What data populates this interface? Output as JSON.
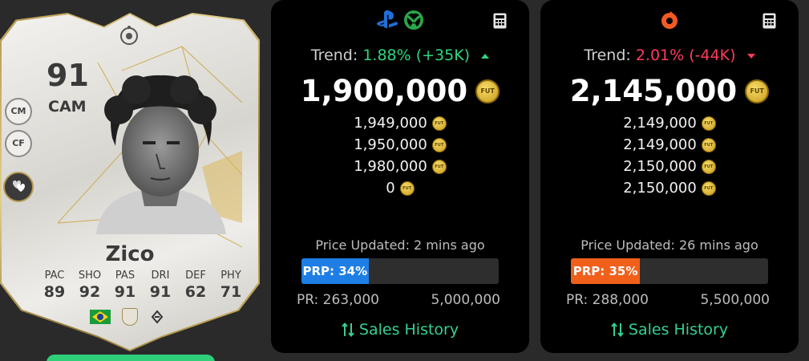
{
  "card": {
    "rating": "91",
    "position": "CAM",
    "alt_positions": [
      "CM",
      "CF"
    ],
    "name": "Zico",
    "stats": [
      {
        "label": "PAC",
        "value": "89"
      },
      {
        "label": "SHO",
        "value": "92"
      },
      {
        "label": "PAS",
        "value": "91"
      },
      {
        "label": "DRI",
        "value": "91"
      },
      {
        "label": "DEF",
        "value": "62"
      },
      {
        "label": "PHY",
        "value": "71"
      }
    ],
    "nation_icon": "brazil-flag",
    "club_icon": "icons-club-badge",
    "league_icon": "icons-league-badge"
  },
  "panels": {
    "console": {
      "platform_icons": [
        "playstation-icon",
        "xbox-icon"
      ],
      "trend_label": "Trend:",
      "trend_value": "1.88% (+35K)",
      "trend_direction": "up",
      "price": "1,900,000",
      "coin_label": "FUT",
      "bins": [
        "1,949,000",
        "1,950,000",
        "1,980,000",
        "0"
      ],
      "updated": "Price Updated: 2 mins ago",
      "prp_label": "PRP: 34%",
      "prp_percent": 34,
      "pr_min": "PR: 263,000",
      "pr_max": "5,000,000",
      "sales_label": "Sales History"
    },
    "pc": {
      "platform_icons": [
        "origin-icon"
      ],
      "trend_label": "Trend:",
      "trend_value": "2.01% (-44K)",
      "trend_direction": "down",
      "price": "2,145,000",
      "coin_label": "FUT",
      "bins": [
        "2,149,000",
        "2,149,000",
        "2,150,000",
        "2,150,000"
      ],
      "updated": "Price Updated: 26 mins ago",
      "prp_label": "PRP: 35%",
      "prp_percent": 35,
      "pr_min": "PR: 288,000",
      "pr_max": "5,500,000",
      "sales_label": "Sales History"
    }
  },
  "colors": {
    "trend_up": "#2fd57c",
    "trend_down": "#ff3b5b",
    "prp_console": "#1e7ee6",
    "prp_pc": "#f1601b",
    "sales_link": "#35d193"
  }
}
